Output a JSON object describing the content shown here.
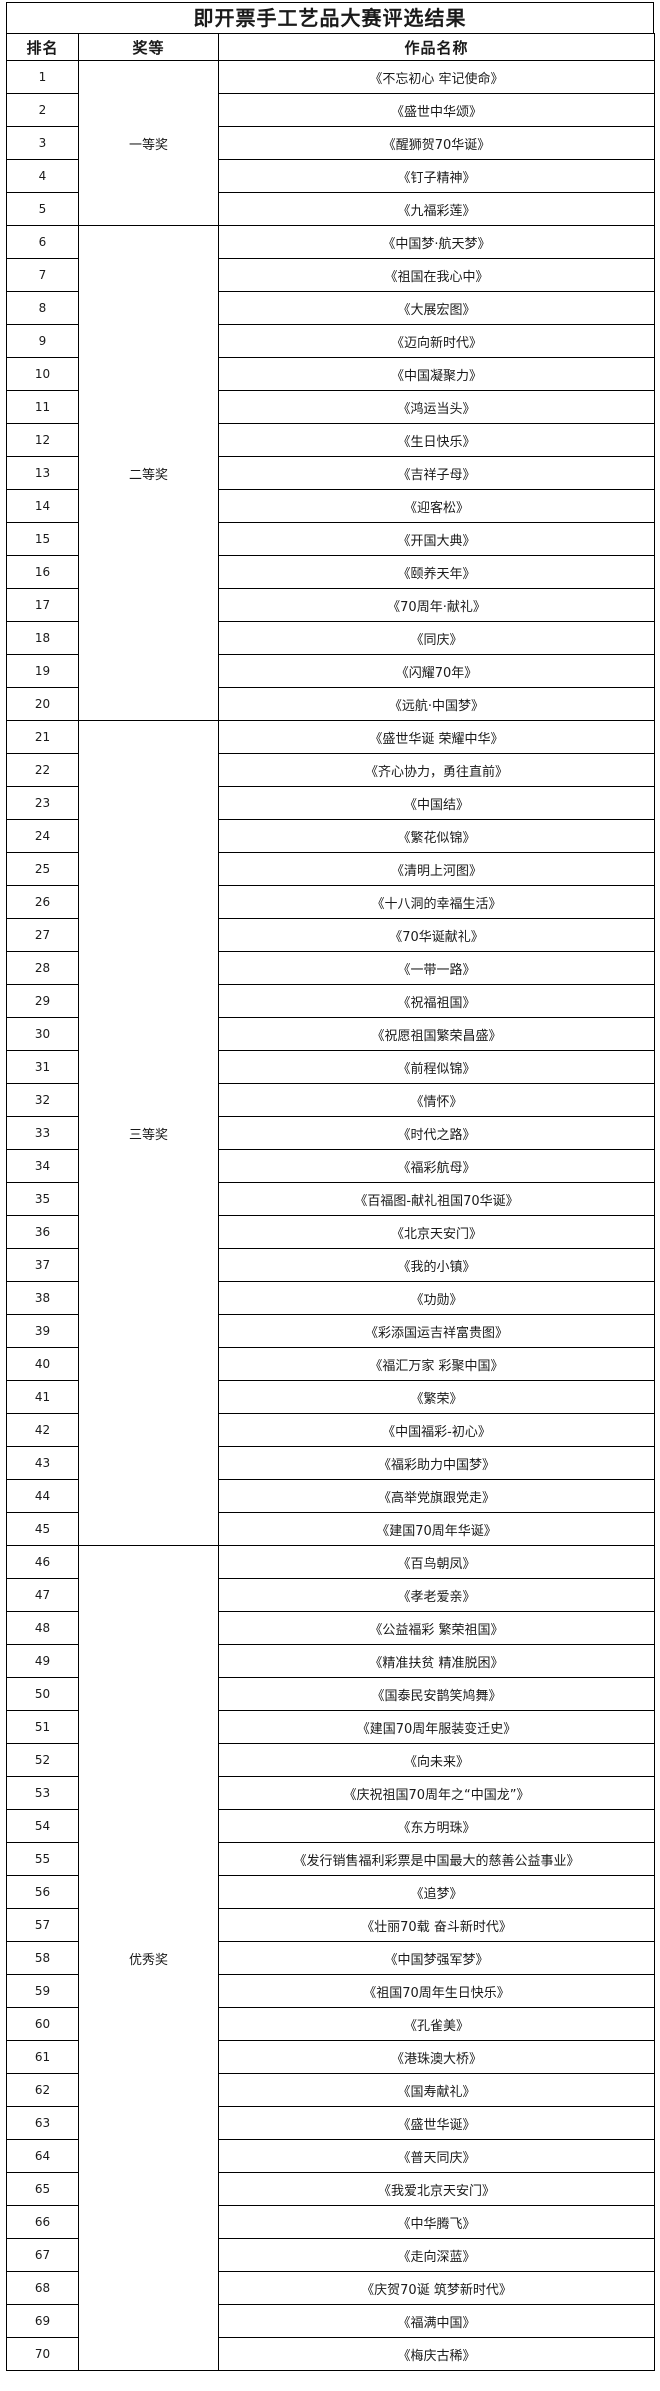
{
  "title": "即开票手工艺品大赛评选结果",
  "headers": {
    "rank": "排名",
    "prize": "奖等",
    "work": "作品名称"
  },
  "groups": [
    {
      "prize": "一等奖",
      "rows": [
        {
          "rank": "1",
          "work": "《不忘初心 牢记使命》"
        },
        {
          "rank": "2",
          "work": "《盛世中华颂》"
        },
        {
          "rank": "3",
          "work": "《醒狮贺70华诞》"
        },
        {
          "rank": "4",
          "work": "《钉子精神》"
        },
        {
          "rank": "5",
          "work": "《九福彩莲》"
        }
      ]
    },
    {
      "prize": "二等奖",
      "rows": [
        {
          "rank": "6",
          "work": "《中国梦·航天梦》"
        },
        {
          "rank": "7",
          "work": "《祖国在我心中》"
        },
        {
          "rank": "8",
          "work": "《大展宏图》"
        },
        {
          "rank": "9",
          "work": "《迈向新时代》"
        },
        {
          "rank": "10",
          "work": "《中国凝聚力》"
        },
        {
          "rank": "11",
          "work": "《鸿运当头》"
        },
        {
          "rank": "12",
          "work": "《生日快乐》"
        },
        {
          "rank": "13",
          "work": "《吉祥子母》"
        },
        {
          "rank": "14",
          "work": "《迎客松》"
        },
        {
          "rank": "15",
          "work": "《开国大典》"
        },
        {
          "rank": "16",
          "work": "《颐养天年》"
        },
        {
          "rank": "17",
          "work": "《70周年·献礼》"
        },
        {
          "rank": "18",
          "work": "《同庆》"
        },
        {
          "rank": "19",
          "work": "《闪耀70年》"
        },
        {
          "rank": "20",
          "work": "《远航·中国梦》"
        }
      ]
    },
    {
      "prize": "三等奖",
      "rows": [
        {
          "rank": "21",
          "work": "《盛世华诞 荣耀中华》"
        },
        {
          "rank": "22",
          "work": "《齐心协力，勇往直前》"
        },
        {
          "rank": "23",
          "work": "《中国结》"
        },
        {
          "rank": "24",
          "work": "《繁花似锦》"
        },
        {
          "rank": "25",
          "work": "《清明上河图》"
        },
        {
          "rank": "26",
          "work": "《十八洞的幸福生活》"
        },
        {
          "rank": "27",
          "work": "《70华诞献礼》"
        },
        {
          "rank": "28",
          "work": "《一带一路》"
        },
        {
          "rank": "29",
          "work": "《祝福祖国》"
        },
        {
          "rank": "30",
          "work": "《祝愿祖国繁荣昌盛》"
        },
        {
          "rank": "31",
          "work": "《前程似锦》"
        },
        {
          "rank": "32",
          "work": "《情怀》"
        },
        {
          "rank": "33",
          "work": "《时代之路》"
        },
        {
          "rank": "34",
          "work": "《福彩航母》"
        },
        {
          "rank": "35",
          "work": "《百福图-献礼祖国70华诞》"
        },
        {
          "rank": "36",
          "work": "《北京天安门》"
        },
        {
          "rank": "37",
          "work": "《我的小镇》"
        },
        {
          "rank": "38",
          "work": "《功勋》"
        },
        {
          "rank": "39",
          "work": "《彩添国运吉祥富贵图》"
        },
        {
          "rank": "40",
          "work": "《福汇万家 彩聚中国》"
        },
        {
          "rank": "41",
          "work": "《繁荣》"
        },
        {
          "rank": "42",
          "work": "《中国福彩-初心》"
        },
        {
          "rank": "43",
          "work": "《福彩助力中国梦》"
        },
        {
          "rank": "44",
          "work": "《高举党旗跟党走》"
        },
        {
          "rank": "45",
          "work": "《建国70周年华诞》"
        }
      ]
    },
    {
      "prize": "优秀奖",
      "rows": [
        {
          "rank": "46",
          "work": "《百鸟朝凤》"
        },
        {
          "rank": "47",
          "work": "《孝老爱亲》"
        },
        {
          "rank": "48",
          "work": "《公益福彩 繁荣祖国》"
        },
        {
          "rank": "49",
          "work": "《精准扶贫 精准脱困》"
        },
        {
          "rank": "50",
          "work": "《国泰民安鹊笑鸠舞》"
        },
        {
          "rank": "51",
          "work": "《建国70周年服装变迁史》"
        },
        {
          "rank": "52",
          "work": "《向未来》"
        },
        {
          "rank": "53",
          "work": "《庆祝祖国70周年之“中国龙”》"
        },
        {
          "rank": "54",
          "work": "《东方明珠》"
        },
        {
          "rank": "55",
          "work": "《发行销售福利彩票是中国最大的慈善公益事业》"
        },
        {
          "rank": "56",
          "work": "《追梦》"
        },
        {
          "rank": "57",
          "work": "《壮丽70载 奋斗新时代》"
        },
        {
          "rank": "58",
          "work": "《中国梦强军梦》"
        },
        {
          "rank": "59",
          "work": "《祖国70周年生日快乐》"
        },
        {
          "rank": "60",
          "work": "《孔雀美》"
        },
        {
          "rank": "61",
          "work": "《港珠澳大桥》"
        },
        {
          "rank": "62",
          "work": "《国寿献礼》"
        },
        {
          "rank": "63",
          "work": "《盛世华诞》"
        },
        {
          "rank": "64",
          "work": "《普天同庆》"
        },
        {
          "rank": "65",
          "work": "《我爱北京天安门》"
        },
        {
          "rank": "66",
          "work": "《中华腾飞》"
        },
        {
          "rank": "67",
          "work": "《走向深蓝》"
        },
        {
          "rank": "68",
          "work": "《庆贺70诞 筑梦新时代》"
        },
        {
          "rank": "69",
          "work": "《福满中国》"
        },
        {
          "rank": "70",
          "work": "《梅庆古稀》"
        }
      ]
    }
  ]
}
